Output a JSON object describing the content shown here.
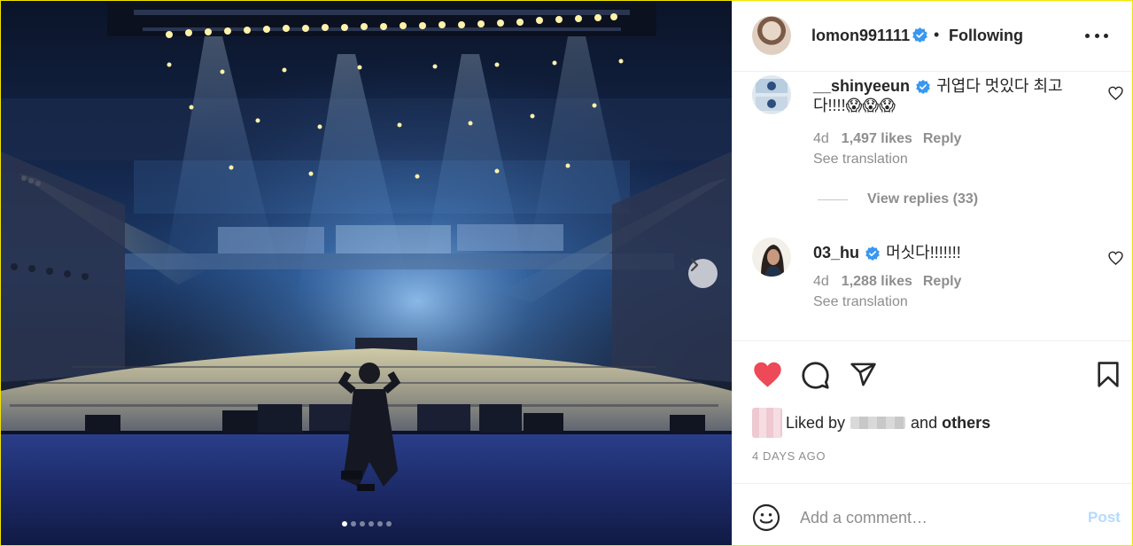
{
  "post": {
    "username": "lomon991111",
    "separator": "•",
    "follow_status": "Following",
    "liked_by_prefix": "Liked by",
    "liked_by_and": "and",
    "liked_by_others": "others",
    "date": "4 DAYS AGO",
    "carousel": {
      "total": 6,
      "active": 1
    }
  },
  "comments": [
    {
      "username": "__shinyeeun",
      "verified": true,
      "text": "귀엽다 멋있다 최고다!!!!😱😱😱",
      "age": "4d",
      "likes": "1,497 likes",
      "reply_label": "Reply",
      "translation_label": "See translation",
      "view_replies": "View replies (33)"
    },
    {
      "username": "03_hu",
      "verified": true,
      "text": "머싯다!!!!!!!",
      "age": "4d",
      "likes": "1,288 likes",
      "reply_label": "Reply",
      "translation_label": "See translation"
    }
  ],
  "add_comment": {
    "placeholder": "Add a comment…",
    "post_label": "Post"
  },
  "icons": {
    "like": "heart-filled-icon",
    "comment": "comment-bubble-icon",
    "share": "paper-plane-icon",
    "save": "bookmark-icon",
    "emoji": "smiley-icon",
    "more": "ellipsis-icon",
    "next": "chevron-right-icon",
    "verified": "verified-badge-icon"
  },
  "colors": {
    "like_red": "#ed4956",
    "verified_blue": "#3897f0",
    "post_disabled": "#b3dbff",
    "muted_text": "#8e8e8e"
  }
}
